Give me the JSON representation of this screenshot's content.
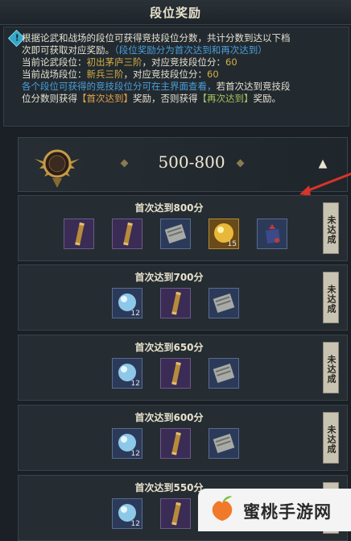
{
  "header": {
    "title": "段位奖励"
  },
  "info": {
    "lines": [
      [
        {
          "text": "根据论武和战场的段位可获得竞技段位分数，共计分数到达以下档",
          "color": "white"
        }
      ],
      [
        {
          "text": "次即可获取对应奖励。",
          "color": "white"
        },
        {
          "text": "（段位奖励分为首次达到和再次达到）",
          "color": "blue"
        }
      ],
      [
        {
          "text": "当前论武段位：",
          "color": "white"
        },
        {
          "text": "初出茅庐三阶",
          "color": "gold"
        },
        {
          "text": "，对应竞技段位分：",
          "color": "white"
        },
        {
          "text": "60",
          "color": "gold"
        }
      ],
      [
        {
          "text": "当前战场段位：",
          "color": "white"
        },
        {
          "text": "新兵三阶",
          "color": "gold"
        },
        {
          "text": "，对应竞技段位分：",
          "color": "white"
        },
        {
          "text": "60",
          "color": "gold"
        }
      ],
      [
        {
          "text": "各个段位可获得的竞技段位分可在主界面查看，",
          "color": "blue"
        },
        {
          "text": "若首次达到竞技段",
          "color": "white"
        }
      ],
      [
        {
          "text": "位分数则获得",
          "color": "white"
        },
        {
          "text": "【首次达到】",
          "color": "orange"
        },
        {
          "text": "奖励，否则获得",
          "color": "white"
        },
        {
          "text": "【再次达到】",
          "color": "green"
        },
        {
          "text": "奖励。",
          "color": "white"
        }
      ]
    ]
  },
  "tier": {
    "range": "500-800",
    "collapse_icon": "chevron-up-icon"
  },
  "rewards": [
    {
      "title": "首次达到800分",
      "status": "未达成",
      "items": [
        {
          "icon": "scroll-icon",
          "qty": ""
        },
        {
          "icon": "scroll-icon",
          "qty": ""
        },
        {
          "icon": "book-icon",
          "qty": ""
        },
        {
          "icon": "gold-orb-icon",
          "qty": "15"
        },
        {
          "icon": "pouch-icon",
          "qty": ""
        }
      ]
    },
    {
      "title": "首次达到700分",
      "status": "未达成",
      "items": [
        {
          "icon": "pearl-icon",
          "qty": "12"
        },
        {
          "icon": "scroll-icon",
          "qty": ""
        },
        {
          "icon": "book-icon",
          "qty": ""
        }
      ]
    },
    {
      "title": "首次达到650分",
      "status": "未达成",
      "items": [
        {
          "icon": "pearl-icon",
          "qty": "12"
        },
        {
          "icon": "scroll-icon",
          "qty": ""
        },
        {
          "icon": "book-icon",
          "qty": ""
        }
      ]
    },
    {
      "title": "首次达到600分",
      "status": "未达成",
      "items": [
        {
          "icon": "pearl-icon",
          "qty": "12"
        },
        {
          "icon": "scroll-icon",
          "qty": ""
        },
        {
          "icon": "book-icon",
          "qty": ""
        }
      ]
    },
    {
      "title": "首次达到550分",
      "status": "未达成",
      "items": [
        {
          "icon": "pearl-icon",
          "qty": "12"
        },
        {
          "icon": "scroll-icon",
          "qty": ""
        },
        {
          "icon": "book-icon",
          "qty": ""
        }
      ]
    }
  ],
  "watermark": {
    "text": "蜜桃手游网"
  },
  "colors": {
    "white": "#e6e1d1",
    "blue": "#4a9fd8",
    "gold": "#d6ad45",
    "orange": "#e3a24a",
    "green": "#a8c25a",
    "annotation_arrow": "#d8342a"
  }
}
